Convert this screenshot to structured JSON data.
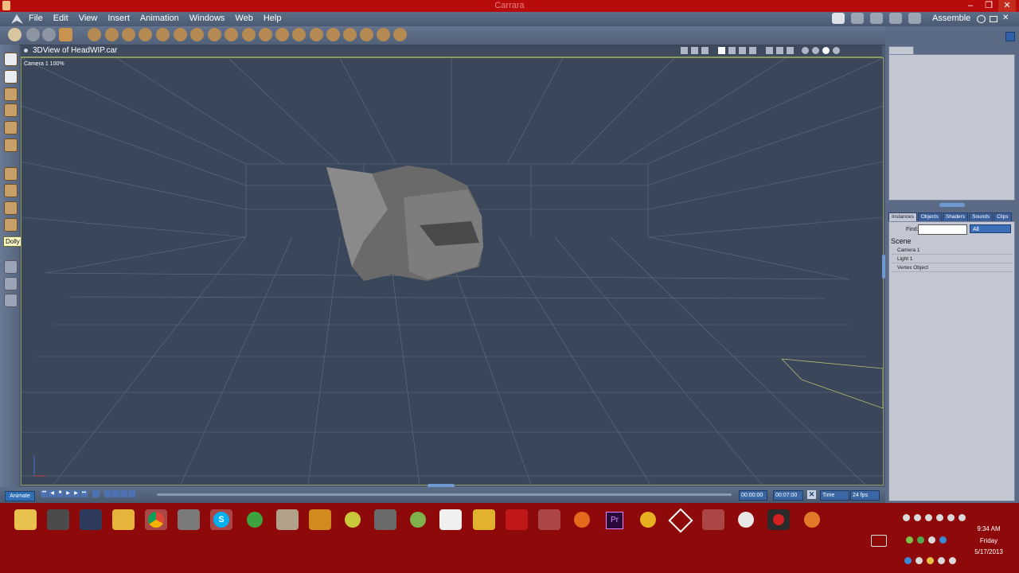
{
  "window": {
    "title": "Carrara",
    "controls": [
      "–",
      "❐",
      "✕"
    ]
  },
  "menu": [
    "File",
    "Edit",
    "View",
    "Insert",
    "Animation",
    "Windows",
    "Web",
    "Help"
  ],
  "workspace": {
    "label": "Assemble"
  },
  "viewport": {
    "title": "3DView of HeadWIP.car",
    "camera_label": "Camera 1 100%"
  },
  "tooltip": "Dolly (D)",
  "timeline": {
    "animate_label": "Animate",
    "start_time": "00:00:00",
    "end_time": "00:07:00",
    "time_mode": "Time",
    "fps": "24 fps"
  },
  "panel": {
    "tabs": [
      "Instances",
      "Objects",
      "Shaders",
      "Sounds",
      "Clips"
    ],
    "find_label": "Find:",
    "find_value": "",
    "filter_value": "All",
    "scene_label": "Scene",
    "scene_items": [
      "Camera 1",
      "Light 1",
      "Vertex Object"
    ]
  },
  "clock": {
    "time": "9:34 AM",
    "day": "Friday",
    "date": "5/17/2013"
  },
  "colors": {
    "titlebar": "#b80c0c",
    "taskbar": "#8e0909",
    "viewport_bg": "#3a4659",
    "grid": "#7d8aa0"
  }
}
